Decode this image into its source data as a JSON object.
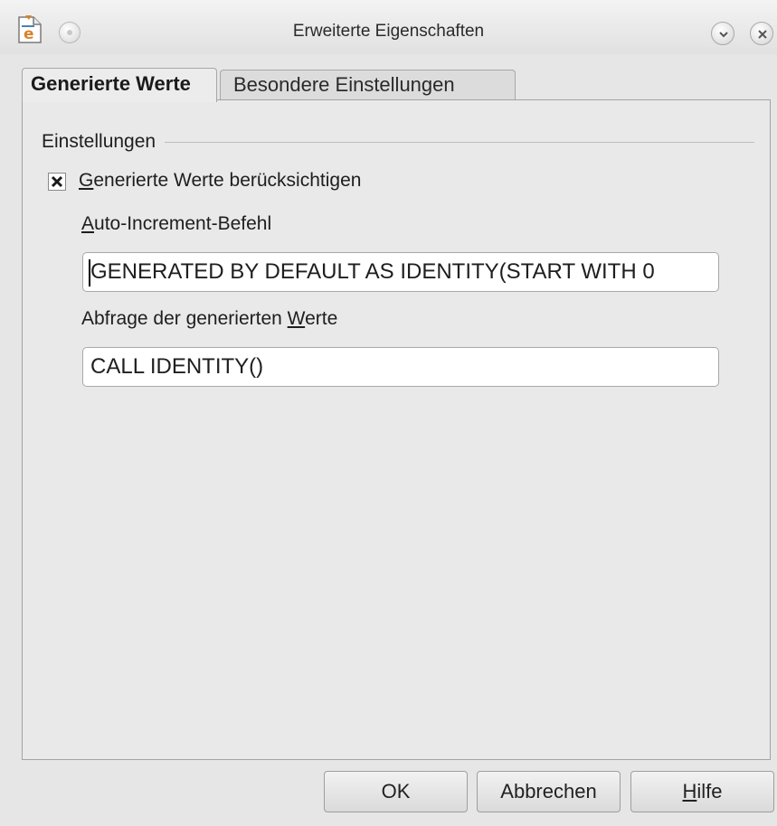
{
  "window": {
    "title": "Erweiterte Eigenschaften"
  },
  "tabs": [
    {
      "label": "Generierte Werte",
      "active": true
    },
    {
      "label": "Besondere Einstellungen",
      "active": false
    }
  ],
  "group": {
    "title": "Einstellungen"
  },
  "checkbox": {
    "label_mnemonic": "G",
    "label_rest": "enerierte Werte berücksichtigen",
    "checked": true
  },
  "auto_increment": {
    "label_mnemonic": "A",
    "label_rest": "uto-Increment-Befehl",
    "value": "GENERATED BY DEFAULT AS IDENTITY(START WITH 0"
  },
  "query": {
    "label_before": "Abfrage der generierten ",
    "label_mnemonic": "W",
    "label_after": "erte",
    "value": "CALL IDENTITY()"
  },
  "buttons": {
    "ok": "OK",
    "cancel": "Abbrechen",
    "help_mnemonic": "H",
    "help_rest": "ilfe"
  },
  "icons": {
    "app": "base-document-icon",
    "menu": "window-menu-icon",
    "minimize": "chevron-down-icon",
    "close": "close-icon"
  },
  "colors": {
    "window_bg": "#e6e6e6",
    "icon_orange": "#d9822b",
    "icon_blue": "#4a7fbf"
  }
}
